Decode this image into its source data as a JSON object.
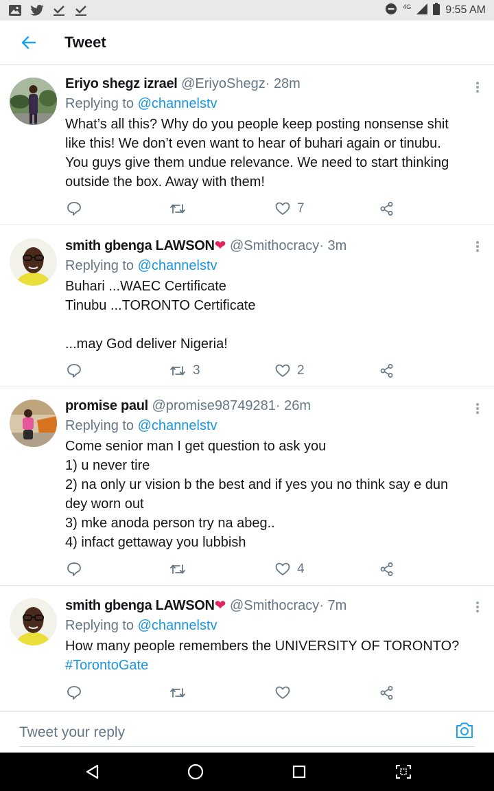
{
  "status_bar": {
    "network": "4G",
    "time": "9:55 AM",
    "left_icons": [
      "image-icon",
      "twitter-icon",
      "check-icon",
      "check-icon"
    ]
  },
  "header": {
    "title": "Tweet",
    "back_icon": "arrow-left-icon"
  },
  "colors": {
    "accent": "#1da1f2",
    "mention": "#1b95e0",
    "secondary_text": "#657786",
    "heart": "#e0245e"
  },
  "tweets": [
    {
      "name": "Eriyo shegz izrael",
      "name_emoji": "",
      "handle": "@EriyoShegz",
      "dot": "·",
      "time": "28m",
      "replying_prefix": "Replying to",
      "replying_to": "@channelstv",
      "lines": [
        "What’s all this? Why do you people keep posting nonsense shit",
        "like this! We don’t even want to hear of buhari again or tinubu.",
        "You guys give them undue relevance. We need to start thinking",
        "outside the box. Away with them!"
      ],
      "retweets": "",
      "likes": "7"
    },
    {
      "name": "smith gbenga LAWSON",
      "name_emoji": "❤",
      "handle": "@Smithocracy",
      "dot": "·",
      "time": "3m",
      "replying_prefix": "Replying to",
      "replying_to": "@channelstv",
      "lines": [
        "Buhari ...WAEC Certificate",
        "Tinubu ...TORONTO Certificate",
        "",
        "...may God deliver Nigeria!"
      ],
      "retweets": "3",
      "likes": "2"
    },
    {
      "name": "promise paul",
      "name_emoji": "",
      "handle": "@promise98749281",
      "dot": "·",
      "time": "26m",
      "replying_prefix": "Replying to",
      "replying_to": "@channelstv",
      "lines": [
        "Come senior man I get question to ask you",
        "1) u never tire",
        "2) na only ur vision b the best and if yes you no think say e dun",
        "dey worn out",
        "3) mke anoda person try na abeg..",
        "4) infact gettaway you lubbish"
      ],
      "retweets": "",
      "likes": "4"
    },
    {
      "name": "smith gbenga LAWSON",
      "name_emoji": "❤",
      "handle": "@Smithocracy",
      "dot": "·",
      "time": "7m",
      "replying_prefix": "Replying to",
      "replying_to": "@channelstv",
      "lines": [
        "How many people remembers the UNIVERSITY OF TORONTO?"
      ],
      "hashtag": "#TorontoGate",
      "retweets": "",
      "likes": ""
    }
  ],
  "reply_bar": {
    "placeholder": "Tweet your reply",
    "camera_icon": "camera-icon"
  },
  "nav_bar": {
    "buttons": [
      "back-triangle-icon",
      "home-circle-icon",
      "recents-square-icon",
      "screenshot-icon"
    ]
  }
}
